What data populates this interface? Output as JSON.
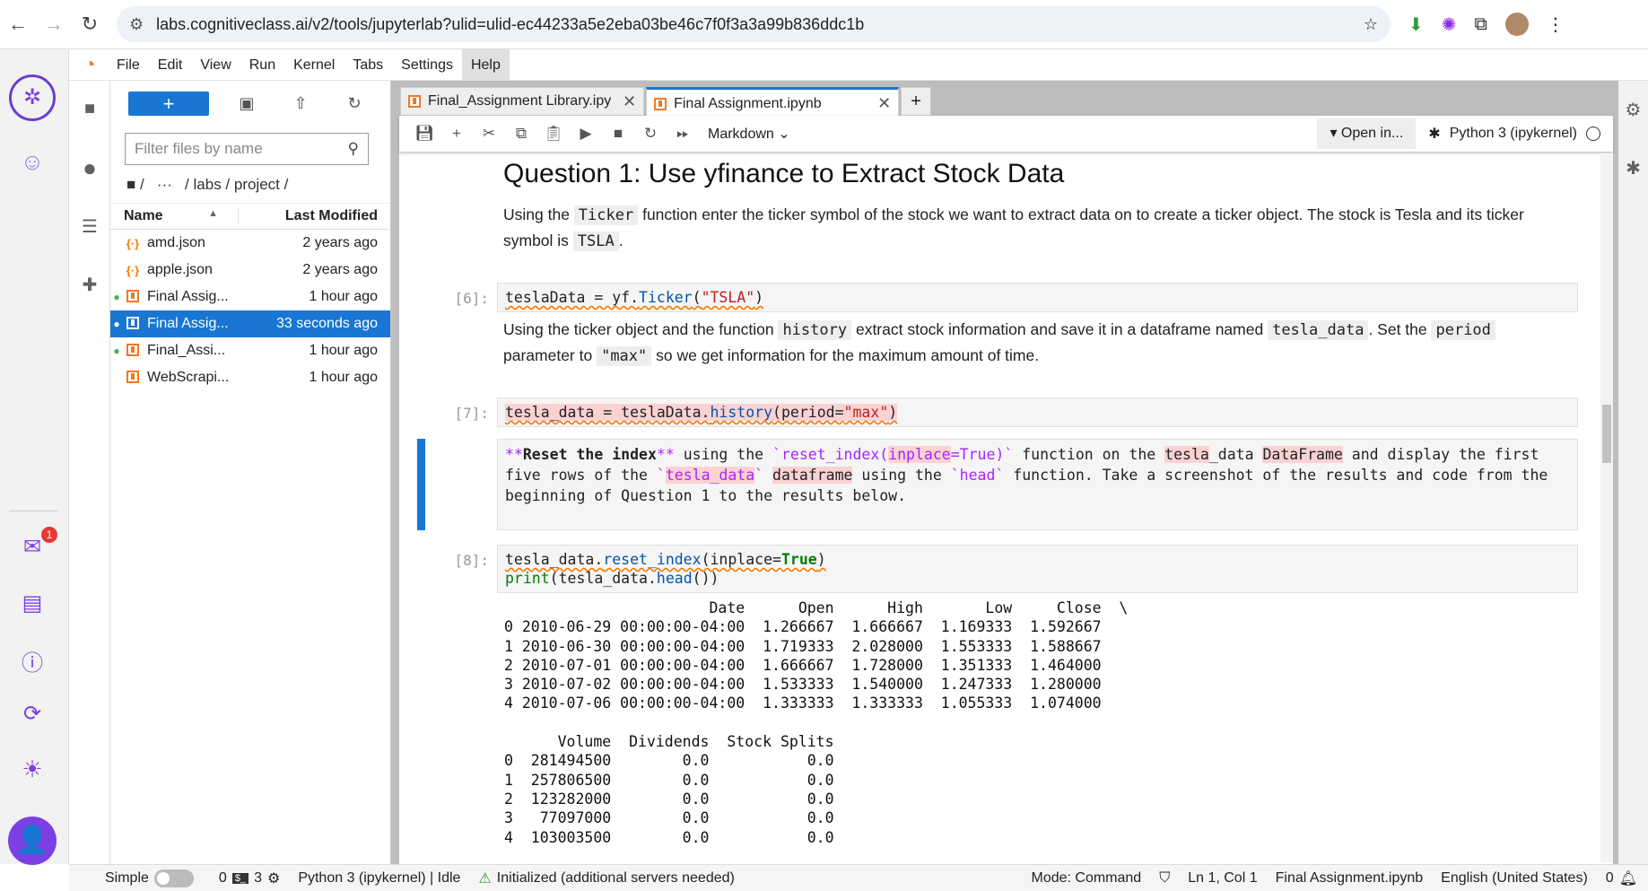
{
  "browser": {
    "url": "labs.cognitiveclass.ai/v2/tools/jupyterlab?ulid=ulid-ec44233a5e2eba03be46c7f0f3a3a99b836ddc1b"
  },
  "menu": [
    "File",
    "Edit",
    "View",
    "Run",
    "Kernel",
    "Tabs",
    "Settings",
    "Help"
  ],
  "filebrowser": {
    "filter_placeholder": "Filter files by name",
    "breadcrumb": "/   ···   / labs / project /",
    "col_name": "Name",
    "col_modified": "Last Modified",
    "files": [
      {
        "name": "amd.json",
        "modified": "2 years ago",
        "type": "json",
        "running": false,
        "selected": false
      },
      {
        "name": "apple.json",
        "modified": "2 years ago",
        "type": "json",
        "running": false,
        "selected": false
      },
      {
        "name": "Final Assig...",
        "modified": "1 hour ago",
        "type": "notebook",
        "running": true,
        "selected": false
      },
      {
        "name": "Final Assig...",
        "modified": "33 seconds ago",
        "type": "notebook",
        "running": true,
        "selected": true
      },
      {
        "name": "Final_Assi...",
        "modified": "1 hour ago",
        "type": "notebook",
        "running": true,
        "selected": false
      },
      {
        "name": "WebScrapi...",
        "modified": "1 hour ago",
        "type": "notebook",
        "running": false,
        "selected": false
      }
    ]
  },
  "tabs": [
    {
      "label": "Final_Assignment Library.ipynb",
      "active": false
    },
    {
      "label": "Final Assignment.ipynb",
      "active": true
    }
  ],
  "toolbar": {
    "cell_type": "Markdown",
    "open_in": "Open in...",
    "kernel": "Python 3 (ipykernel)"
  },
  "notebook": {
    "heading": "Question 1: Use yfinance to Extract Stock Data",
    "p1": {
      "a": "Using the ",
      "c1": "Ticker",
      "b": " function enter the ticker symbol of the stock we want to extract data on to create a ticker object. The stock is Tesla and its ticker symbol is ",
      "c2": "TSLA",
      "d": "."
    },
    "cell6": {
      "prompt": "[6]:",
      "var": "teslaData",
      "op": " = yf.",
      "fn": "Ticker",
      "open": "(",
      "str": "\"TSLA\"",
      "close": ")"
    },
    "p2": {
      "a": "Using the ticker object and the function ",
      "c1": "history",
      "b": " extract stock information and save it in a dataframe named ",
      "c2": "tesla_data",
      "c": ". Set the ",
      "c3": "period",
      "d": " parameter to ",
      "c4": "\"max\"",
      "e": " so we get information for the maximum amount of time."
    },
    "cell7": {
      "prompt": "[7]:",
      "a": "tesla_data = teslaData.",
      "fn": "history",
      "b": "(period=",
      "str": "\"max\"",
      "c": ")"
    },
    "md": {
      "l1a": "**",
      "l1b": "Reset the index",
      "l1c": "**",
      " l1d": "",
      "l1e": " using the ",
      "l1f": "`reset_index(",
      "l1g": "inplace",
      "l1h": "=True)`",
      "l1i": " function on the ",
      "l1j": "tesla",
      "l1k": "_data ",
      "l1l": "DataFrame",
      "l1m": " and display the first",
      "l2a": "five rows of the ",
      "l2b": "`",
      "l2c": "tesla_data",
      "l2d": "`",
      "l2e": " ",
      "l2f": "dataframe",
      "l2g": " using the ",
      "l2h": "`head`",
      "l2i": " function. Take a screenshot of the results and code from the",
      "l3": "beginning of Question 1 to the results below."
    },
    "cell8": {
      "prompt": "[8]:",
      "a": "tesla_data.",
      "fn": "reset_index",
      "b": "(inplace=",
      "kw": "True",
      "c": ")",
      "d": "print",
      "e": "(tesla_data.",
      "fn2": "head",
      "f": "())"
    },
    "output": "                       Date      Open      High       Low     Close  \\\n0 2010-06-29 00:00:00-04:00  1.266667  1.666667  1.169333  1.592667   \n1 2010-06-30 00:00:00-04:00  1.719333  2.028000  1.553333  1.588667   \n2 2010-07-01 00:00:00-04:00  1.666667  1.728000  1.351333  1.464000   \n3 2010-07-02 00:00:00-04:00  1.533333  1.540000  1.247333  1.280000   \n4 2010-07-06 00:00:00-04:00  1.333333  1.333333  1.055333  1.074000   \n\n      Volume  Dividends  Stock Splits  \n0  281494500        0.0           0.0  \n1  257806500        0.0           0.0  \n2  123282000        0.0           0.0  \n3   77097000        0.0           0.0  \n4  103003500        0.0           0.0  "
  },
  "status": {
    "simple": "Simple",
    "terminals": "0",
    "kernels": "3",
    "kernel_status": "Python 3 (ipykernel) | Idle",
    "lsp": "Initialized (additional servers needed)",
    "mode": "Mode: Command",
    "position": "Ln 1, Col 1",
    "file": "Final Assignment.ipynb",
    "language": "English (United States)",
    "notifications": "0"
  },
  "sidebar": {
    "inbox_badge": "1"
  },
  "colors": {
    "accent": "#1976d2",
    "jupyter_orange": "#f37726",
    "cohort_purple": "#7b3fe4"
  }
}
